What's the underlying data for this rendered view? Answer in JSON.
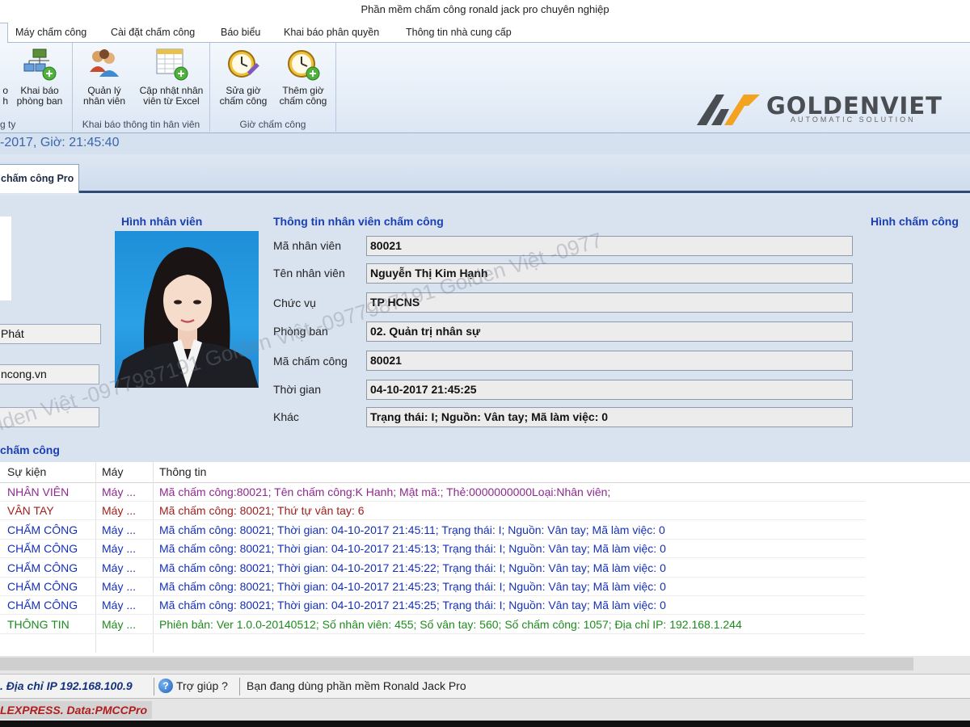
{
  "window": {
    "title": "Phần mềm chấm công ronald jack pro chuyên nghiệp"
  },
  "menu": {
    "tabs": [
      "Máy chấm công",
      "Cài đặt chấm công",
      "Báo biểu",
      "Khai báo  phân quyền",
      "Thông tin nhà cung cấp"
    ]
  },
  "ribbon": {
    "group1": {
      "label": "g ty",
      "cut_label": "o\nh",
      "btn_label": "Khai báo\nphòng ban"
    },
    "group2": {
      "label": "Khai báo thông tin hân viên",
      "btn1_label": "Quản lý\nnhân viên",
      "btn2_label": "Cập nhật nhân\nviên từ Excel"
    },
    "group3": {
      "label": "Giờ chấm công",
      "btn1_label": "Sửa giờ\nchấm công",
      "btn2_label": "Thêm giờ\nchấm công"
    }
  },
  "logo": {
    "name": "GOLDENVIET",
    "tagline": "AUTOMATIC SOLUTION"
  },
  "datebar": {
    "text": "-2017, Giờ: 21:45:40"
  },
  "doc_tab": {
    "label": "chấm công Pro"
  },
  "left_panel": {
    "field1": "Phát",
    "field2": "ncong.vn",
    "field3": ""
  },
  "photo_section": {
    "title": "Hình nhân viên"
  },
  "info": {
    "title": "Thông tin nhân viên chấm công",
    "fields": [
      {
        "label": "Mã nhân viên",
        "value": "80021"
      },
      {
        "label": "Tên nhân viên",
        "value": "Nguyễn Thị Kim Hạnh"
      },
      {
        "label": "Chức vụ",
        "value": "TP HCNS"
      },
      {
        "label": "Phòng ban",
        "value": "02. Quản trị nhân sự"
      },
      {
        "label": "Mã chấm công",
        "value": "80021"
      },
      {
        "label": "Thời gian",
        "value": "04-10-2017 21:45:25"
      },
      {
        "label": "Khác",
        "value": "Trạng thái: I; Nguồn: Vân tay; Mã làm việc: 0"
      }
    ]
  },
  "attendance_photo": {
    "title": "Hình chấm công"
  },
  "log_section": {
    "title": "chấm công"
  },
  "log": {
    "headers": [
      "Sự kiện",
      "Máy",
      "Thông tin"
    ],
    "rows": [
      {
        "event": "NHÂN VIÊN",
        "machine": "Máy ...",
        "info": "Mã chấm công:80021; Tên chấm công:K Hanh; Mật mã:; Thẻ:0000000000Loại:Nhân viên;",
        "color": "#8e2a8e"
      },
      {
        "event": "VÂN TAY",
        "machine": "Máy ...",
        "info": "Mã chấm công: 80021; Thứ tự vân tay: 6",
        "color": "#a0201e"
      },
      {
        "event": "CHẤM CÔNG",
        "machine": "Máy ...",
        "info": "Mã chấm công: 80021; Thời gian: 04-10-2017 21:45:11; Trạng thái: I; Nguồn: Vân tay; Mã làm việc: 0",
        "color": "#1530b8"
      },
      {
        "event": "CHẤM CÔNG",
        "machine": "Máy ...",
        "info": "Mã chấm công: 80021; Thời gian: 04-10-2017 21:45:13; Trạng thái: I; Nguồn: Vân tay; Mã làm việc: 0",
        "color": "#1530b8"
      },
      {
        "event": "CHẤM CÔNG",
        "machine": "Máy ...",
        "info": "Mã chấm công: 80021; Thời gian: 04-10-2017 21:45:22; Trạng thái: I; Nguồn: Vân tay; Mã làm việc: 0",
        "color": "#1530b8"
      },
      {
        "event": "CHẤM CÔNG",
        "machine": "Máy ...",
        "info": "Mã chấm công: 80021; Thời gian: 04-10-2017 21:45:23; Trạng thái: I; Nguồn: Vân tay; Mã làm việc: 0",
        "color": "#1530b8"
      },
      {
        "event": "CHẤM CÔNG",
        "machine": "Máy ...",
        "info": "Mã chấm công: 80021; Thời gian: 04-10-2017 21:45:25; Trạng thái: I; Nguồn: Vân tay; Mã làm việc: 0",
        "color": "#1530b8"
      },
      {
        "event": "THÔNG TIN",
        "machine": "Máy ...",
        "info": "Phiên bản: Ver 1.0.0-20140512; Số nhân viên: 455; Số vân tay: 560; Số chấm công: 1057; Địa chỉ IP: 192.168.1.244",
        "color": "#1e8a1e"
      }
    ]
  },
  "watermark": {
    "text": "Golden Việt -0977987191 Golden Việt -0977987191 Golden Việt -0977"
  },
  "status": {
    "ip": ". Địa chỉ IP 192.168.100.9",
    "help": "Trợ giúp ?",
    "message": "Bạn đang dùng phần mềm Ronald Jack Pro"
  },
  "bottom": {
    "text": "LEXPRESS. Data:PMCCPro"
  }
}
